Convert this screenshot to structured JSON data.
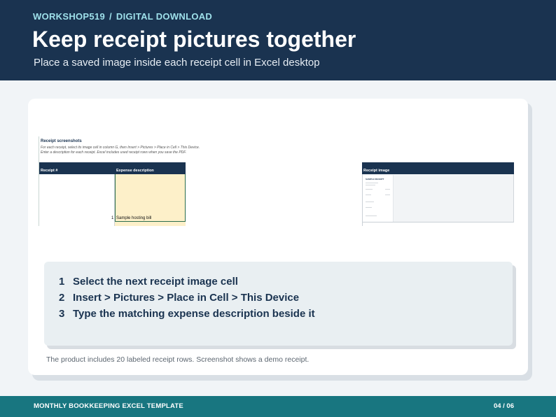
{
  "header": {
    "brand": "WORKSHOP519",
    "separator": "/",
    "category": "DIGITAL DOWNLOAD",
    "title": "Keep receipt pictures together",
    "subtitle": "Place a saved image inside each receipt cell in Excel desktop"
  },
  "screenshot": {
    "sheet_title": "Receipt screenshots",
    "instruction_1": "For each receipt, select its image cell in column G, then Insert > Pictures > Place in Cell > This Device.",
    "instruction_2": "Enter a description for each receipt. Excel includes used receipt rows when you save the PDF.",
    "columns": [
      "Receipt #",
      "Expense description",
      "Receipt image"
    ],
    "row": {
      "number": "1",
      "description": "Sample hosting bill"
    },
    "thumbnail": {
      "heading": "SAMPLE RECEIPT"
    }
  },
  "steps": [
    {
      "number": "1",
      "text": "Select the next receipt image cell"
    },
    {
      "number": "2",
      "text": "Insert > Pictures > Place in Cell > This Device"
    },
    {
      "number": "3",
      "text": "Type the matching expense description beside it"
    }
  ],
  "footnote": "The product includes 20 labeled receipt rows. Screenshot shows a demo receipt.",
  "footer": {
    "product": "MONTHLY BOOKKEEPING EXCEL TEMPLATE",
    "page": "04 / 06"
  },
  "colors": {
    "header_bg": "#1a3350",
    "kicker": "#9ee0ea",
    "footer_bg": "#187680",
    "panel_bg": "#e9eff2",
    "highlight_cell": "#fdf0c9"
  }
}
